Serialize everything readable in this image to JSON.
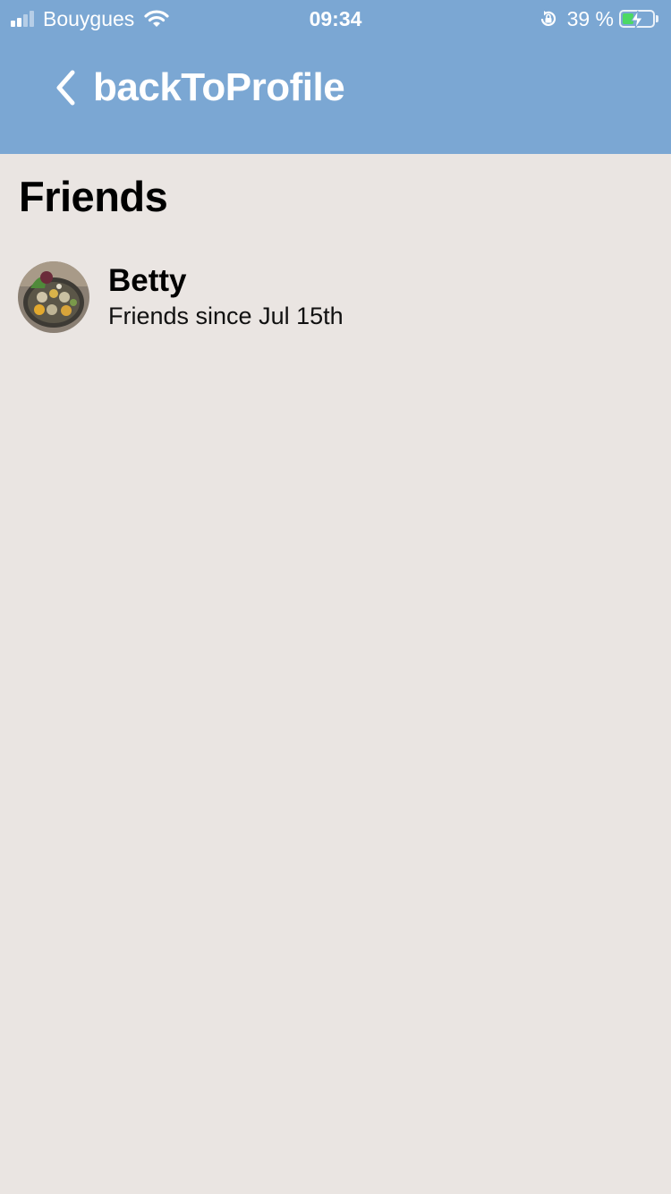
{
  "status_bar": {
    "carrier": "Bouygues",
    "time": "09:34",
    "battery_percent": "39 %",
    "signal_bars_filled": 2,
    "signal_bars_total": 4,
    "battery_level": 0.39,
    "icons": [
      "signal-icon",
      "wifi-icon",
      "orientation-lock-icon",
      "battery-icon",
      "charging-bolt-icon"
    ]
  },
  "nav": {
    "back_icon": "chevron-left-icon",
    "title": "backToProfile"
  },
  "page": {
    "title": "Friends"
  },
  "friends": [
    {
      "name": "Betty",
      "since": "Friends since Jul 15th"
    }
  ],
  "colors": {
    "header_bg": "#7BA7D3",
    "page_bg": "#EAE5E2",
    "battery_charging": "#4CD964"
  }
}
